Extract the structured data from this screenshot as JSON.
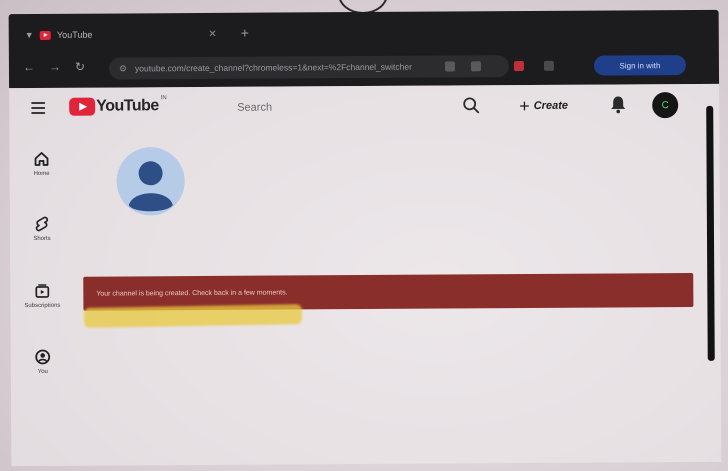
{
  "browser": {
    "tab_title": "YouTube",
    "url": "youtube.com/create_channel?chromeless=1&next=%2Fchannel_switcher",
    "signin_label": "Sign in with"
  },
  "youtube": {
    "logo_text": "YouTube",
    "logo_country": "IN",
    "search_placeholder": "Search",
    "create_label": "Create",
    "avatar_letter": "C",
    "sidebar": {
      "items": [
        {
          "label": "Home",
          "icon": "home-icon"
        },
        {
          "label": "Shorts",
          "icon": "shorts-icon"
        },
        {
          "label": "Subscriptions",
          "icon": "subscriptions-icon"
        },
        {
          "label": "You",
          "icon": "you-icon"
        }
      ]
    },
    "notice": "Your channel is being created. Check back in a few moments."
  },
  "colors": {
    "brand_red": "#e0243a",
    "notice_background": "#8a2e2c",
    "browser_chrome": "#1c1b1d"
  }
}
